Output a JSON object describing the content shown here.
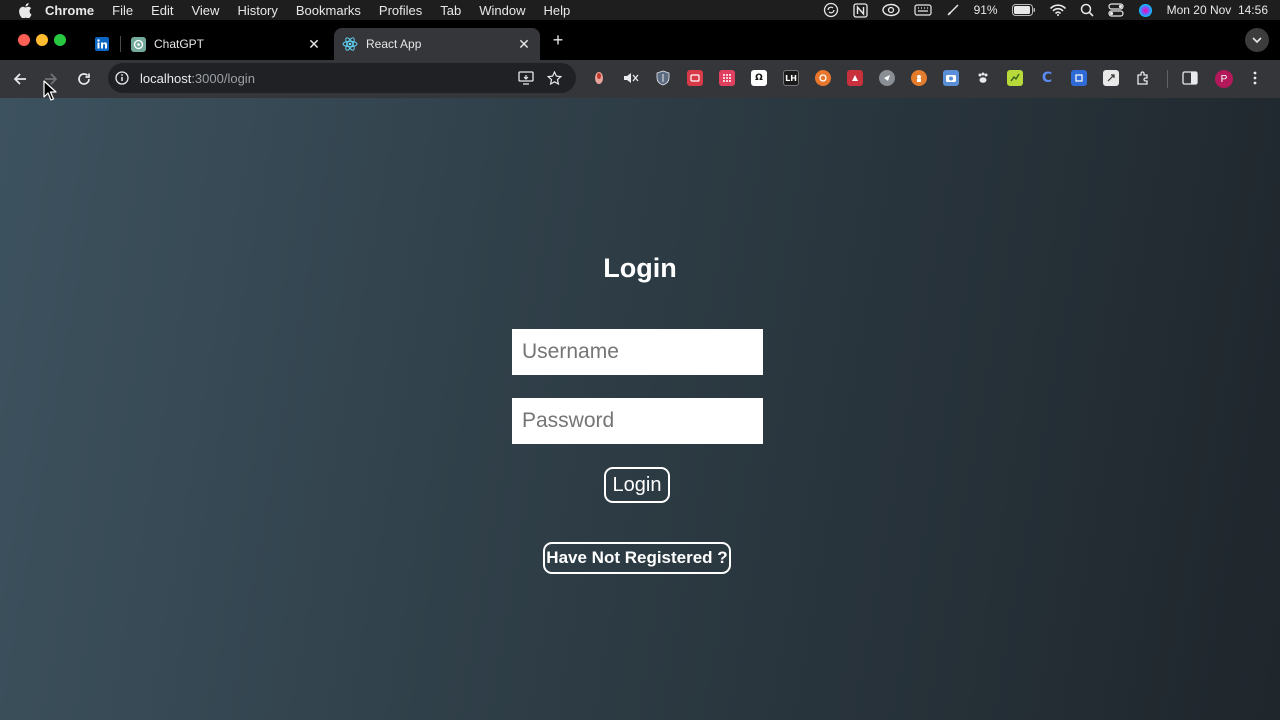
{
  "menubar": {
    "app": "Chrome",
    "items": [
      "File",
      "Edit",
      "View",
      "History",
      "Bookmarks",
      "Profiles",
      "Tab",
      "Window",
      "Help"
    ],
    "battery": "91%",
    "datetime": "Mon 20 Nov  14:56"
  },
  "tabs": {
    "linkedin": {
      "icon": "linkedin-icon"
    },
    "chatgpt": {
      "title": "ChatGPT",
      "close": "✕"
    },
    "react": {
      "title": "React App",
      "close": "✕"
    },
    "new_tab": "+"
  },
  "toolbar": {
    "url_host": "localhost",
    "url_path": ":3000/login",
    "profile_initial": "P"
  },
  "extensions": [
    {
      "name": "ext-1",
      "label": "",
      "color": "#e8a39a"
    },
    {
      "name": "mute-tab",
      "label": "",
      "color": ""
    },
    {
      "name": "brave-shield",
      "label": "",
      "color": "#5b6b80"
    },
    {
      "name": "ext-red",
      "label": "",
      "color": "#d93a4a"
    },
    {
      "name": "ext-grid",
      "label": "",
      "color": "#e04060"
    },
    {
      "name": "ext-omega",
      "label": "Ω",
      "color": "#ffffff"
    },
    {
      "name": "ext-lighthouse",
      "label": "LH",
      "color": "#1a1a1a"
    },
    {
      "name": "ext-orange-circle",
      "label": "",
      "color": "#e8762d"
    },
    {
      "name": "ext-red-box",
      "label": "",
      "color": "#c9303e"
    },
    {
      "name": "ext-gray-circle",
      "label": "",
      "color": "#8a8f96"
    },
    {
      "name": "ext-orange-2",
      "label": "",
      "color": "#e37c2c"
    },
    {
      "name": "ext-camera",
      "label": "",
      "color": "#5a8fd8"
    },
    {
      "name": "ext-paw",
      "label": "",
      "color": ""
    },
    {
      "name": "ext-lime",
      "label": "",
      "color": "#b8d93a"
    },
    {
      "name": "ext-c",
      "label": "C",
      "color": ""
    },
    {
      "name": "ext-blue-box",
      "label": "",
      "color": "#2f6bd6"
    },
    {
      "name": "ext-white",
      "label": "",
      "color": "#e8e8e8"
    }
  ],
  "login": {
    "title": "Login",
    "username_placeholder": "Username",
    "password_placeholder": "Password",
    "login_button": "Login",
    "register_button": "Have Not Registered ?"
  },
  "colors": {
    "page_gradient_start": "#3d525f",
    "page_gradient_end": "#1f262c",
    "toolbar": "#35363a",
    "tabstrip": "#000000"
  }
}
